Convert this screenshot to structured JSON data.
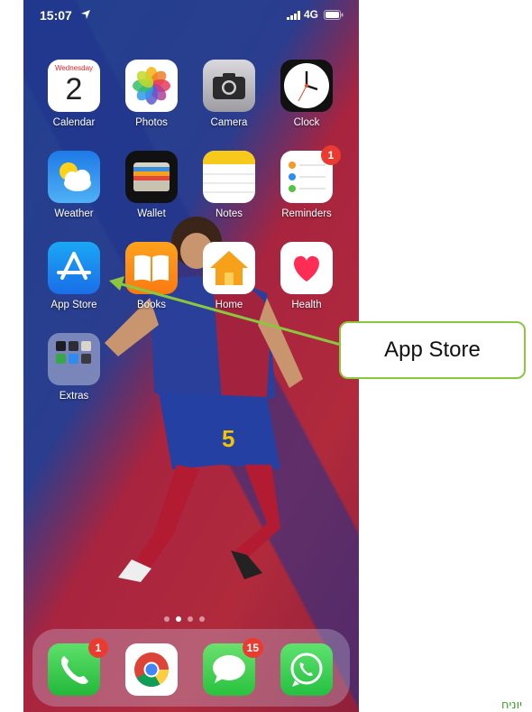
{
  "status_bar": {
    "time": "15:07",
    "network": "4G"
  },
  "apps": {
    "calendar": {
      "label": "Calendar",
      "weekday": "Wednesday",
      "date": "2"
    },
    "photos": {
      "label": "Photos"
    },
    "camera": {
      "label": "Camera"
    },
    "clock": {
      "label": "Clock"
    },
    "weather": {
      "label": "Weather"
    },
    "wallet": {
      "label": "Wallet"
    },
    "notes": {
      "label": "Notes"
    },
    "reminders": {
      "label": "Reminders",
      "badge": "1"
    },
    "app_store": {
      "label": "App Store"
    },
    "books": {
      "label": "Books"
    },
    "home": {
      "label": "Home"
    },
    "health": {
      "label": "Health"
    },
    "extras": {
      "label": "Extras"
    }
  },
  "dock": {
    "phone": {
      "badge": "1"
    },
    "chrome": {},
    "messages": {
      "badge": "15"
    },
    "whatsapp": {}
  },
  "page_indicator": {
    "pages": 4,
    "active": 2
  },
  "callout": {
    "text": "App Store"
  },
  "footer": {
    "text": "יוניח"
  },
  "colors": {
    "callout_border": "#8cc63f",
    "badge": "#ea3b30",
    "footer_text": "#3f9f2d"
  }
}
